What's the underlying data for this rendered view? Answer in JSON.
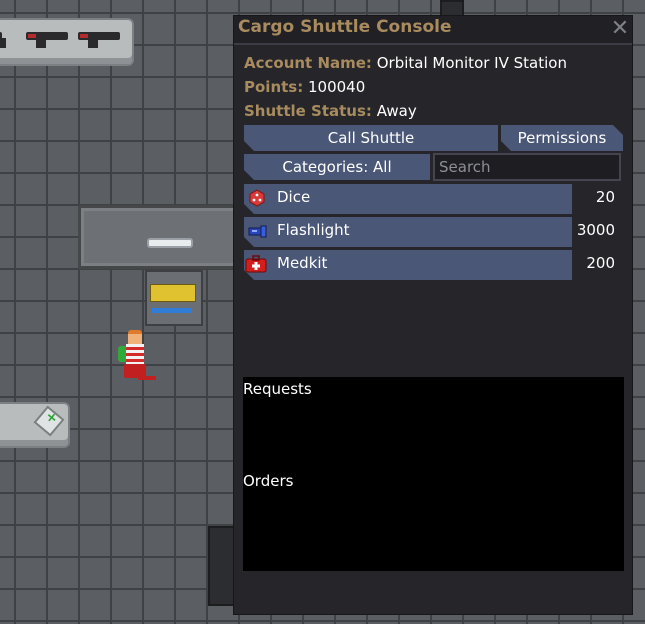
{
  "window": {
    "title": "Cargo Shuttle Console",
    "close_glyph": "✕"
  },
  "account": {
    "name_label": "Account Name:",
    "name_value": "Orbital Monitor IV Station",
    "points_label": "Points:",
    "points_value": "100040",
    "status_label": "Shuttle Status:",
    "status_value": "Away"
  },
  "buttons": {
    "call_shuttle": "Call Shuttle",
    "permissions": "Permissions",
    "categories": "Categories: All"
  },
  "search": {
    "placeholder": "Search"
  },
  "products": [
    {
      "name": "Dice",
      "cost": "20",
      "icon": "dice-icon"
    },
    {
      "name": "Flashlight",
      "cost": "3000",
      "icon": "flashlight-icon"
    },
    {
      "name": "Medkit",
      "cost": "200",
      "icon": "medkit-icon"
    }
  ],
  "panes": {
    "requests": "Requests",
    "orders": "Orders"
  },
  "colors": {
    "accent": "#a88b5e",
    "button": "#4b5777",
    "window_bg": "#25252a"
  }
}
